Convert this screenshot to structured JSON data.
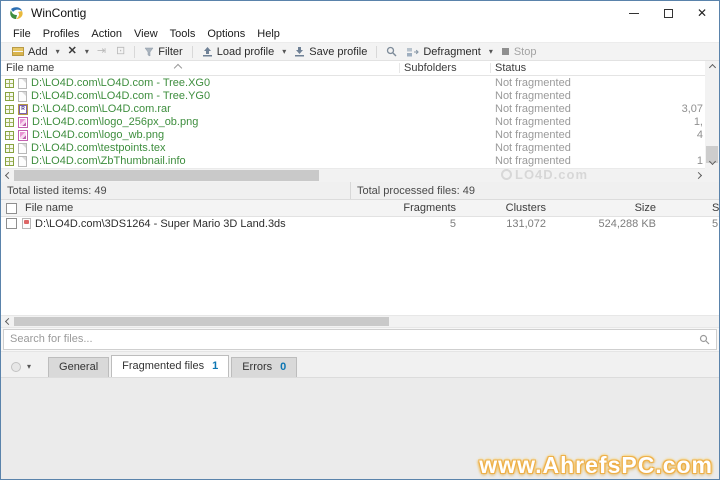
{
  "window": {
    "title": "WinContig"
  },
  "menu": {
    "items": [
      "File",
      "Profiles",
      "Action",
      "View",
      "Tools",
      "Options",
      "Help"
    ]
  },
  "toolbar": {
    "add_label": "Add",
    "filter_label": "Filter",
    "load_profile_label": "Load profile",
    "save_profile_label": "Save profile",
    "defragment_label": "Defragment",
    "stop_label": "Stop"
  },
  "file_list": {
    "columns": {
      "file_name": "File name",
      "subfolders": "Subfolders",
      "status": "Status"
    },
    "rows": [
      {
        "path": "D:\\LO4D.com\\LO4D.com - Tree.XG0",
        "icon": "doc",
        "status": "Not fragmented",
        "size_partial": ""
      },
      {
        "path": "D:\\LO4D.com\\LO4D.com - Tree.YG0",
        "icon": "doc",
        "status": "Not fragmented",
        "size_partial": ""
      },
      {
        "path": "D:\\LO4D.com\\LO4D.com.rar",
        "icon": "rar",
        "status": "Not fragmented",
        "size_partial": "3,07"
      },
      {
        "path": "D:\\LO4D.com\\logo_256px_ob.png",
        "icon": "png",
        "status": "Not fragmented",
        "size_partial": "1,"
      },
      {
        "path": "D:\\LO4D.com\\logo_wb.png",
        "icon": "png",
        "status": "Not fragmented",
        "size_partial": "4"
      },
      {
        "path": "D:\\LO4D.com\\testpoints.tex",
        "icon": "doc",
        "status": "Not fragmented",
        "size_partial": ""
      },
      {
        "path": "D:\\LO4D.com\\ZbThumbnail.info",
        "icon": "doc",
        "status": "Not fragmented",
        "size_partial": "1"
      }
    ]
  },
  "totals": {
    "listed": "Total listed items: 49",
    "processed": "Total processed files: 49"
  },
  "fragmented_list": {
    "columns": {
      "file_name": "File name",
      "fragments": "Fragments",
      "clusters": "Clusters",
      "size": "Size",
      "status_clipped": "S"
    },
    "rows": [
      {
        "path": "D:\\LO4D.com\\3DS1264 - Super Mario 3D Land.3ds",
        "icon": "tds",
        "fragments": "5",
        "clusters": "131,072",
        "size": "524,288 KB",
        "status_clipped": "5"
      }
    ]
  },
  "search": {
    "placeholder": "Search for files..."
  },
  "tabs": [
    {
      "label": "General",
      "count": null,
      "active": false
    },
    {
      "label": "Fragmented files",
      "count": "1",
      "active": true
    },
    {
      "label": "Errors",
      "count": "0",
      "active": false
    }
  ],
  "watermarks": {
    "corner": "www.AhrefsPC.com",
    "faint": "LO4D.com"
  },
  "colors": {
    "path_green": "#3e8e3e",
    "status_gray": "#9a9a9a",
    "count_blue": "#0c76b3",
    "toolbar_bg": "#f3f3f3",
    "window_border": "#5a83ab"
  }
}
